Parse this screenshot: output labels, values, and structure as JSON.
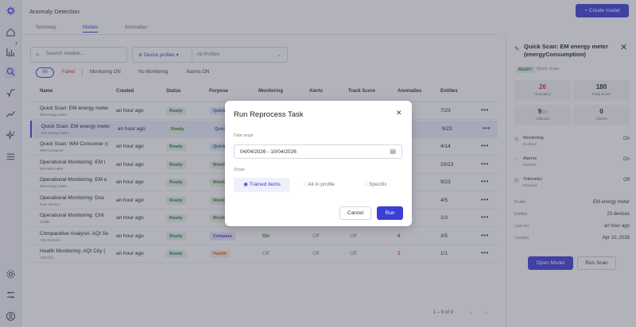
{
  "header": {
    "title": "Anomaly Detection",
    "create_label": "+ Create model"
  },
  "tabs": [
    {
      "label": "Summary"
    },
    {
      "label": "Models"
    },
    {
      "label": "Anomalies"
    }
  ],
  "filters": {
    "search_placeholder": "Search models...",
    "profile_label": "Device profiles",
    "profile_value": "All Profiles",
    "chips": [
      "All",
      "Failed",
      "Monitoring ON",
      "No Monitoring",
      "Alarms ON"
    ]
  },
  "table": {
    "columns": [
      "Name",
      "Created",
      "Status",
      "Purpose",
      "Monitoring",
      "Alerts",
      "Track Score",
      "Anomalies",
      "Entities"
    ],
    "rows": [
      {
        "name": "Quick Scan: EM energy meter",
        "sub": "EM energy meter",
        "created": "an hour ago",
        "status": "Ready",
        "purpose": "Quick",
        "entities": "7/23"
      },
      {
        "name": "Quick Scan: EM energy meter",
        "sub": "EM energy meter",
        "created": "an hour ago",
        "status": "Ready",
        "purpose": "Quick",
        "entities": "9/23"
      },
      {
        "name": "Quick Scan: WM Consumer (c",
        "sub": "WM Consumer",
        "created": "an hour ago",
        "status": "Ready",
        "purpose": "Quick",
        "entities": "4/14"
      },
      {
        "name": "Operational Monitoring: EM l",
        "sub": "EM heat meter",
        "created": "an hour ago",
        "status": "Ready",
        "purpose": "Monit",
        "entities": "20/23"
      },
      {
        "name": "Operational Monitoring: EM e",
        "sub": "EM energy meter",
        "created": "an hour ago",
        "status": "Ready",
        "purpose": "Monit",
        "entities": "9/23"
      },
      {
        "name": "Operational Monitoring: Doo",
        "sub": "Door Sensor",
        "created": "an hour ago",
        "status": "Ready",
        "purpose": "Monit",
        "entities": "4/5"
      },
      {
        "name": "Operational Monitoring: Chil",
        "sub": "Chiller",
        "created": "an hour ago",
        "status": "Ready",
        "purpose": "Monit",
        "entities": "1/3"
      },
      {
        "name": "Comparative Analysis: AQI Se",
        "sub": "AQI Sensors",
        "created": "an hour ago",
        "status": "Ready",
        "purpose": "Compare",
        "monitoring": "On",
        "alerts": "Off",
        "track": "Off",
        "anomalies": "6",
        "entities": "3/5"
      },
      {
        "name": "Health Monitoring: AQI City (",
        "sub": "AQI City",
        "created": "an hour ago",
        "status": "Ready",
        "purpose": "Health",
        "monitoring": "Off",
        "alerts": "Off",
        "track": "Off",
        "anomalies": "1",
        "entities": "1/1"
      }
    ],
    "pager": "1 – 9 of 9"
  },
  "panel": {
    "title": "Quick Scan: EM energy meter (energyConsumption)",
    "status": "READY",
    "purpose": "Quick Scan",
    "stats": [
      {
        "value": "26",
        "label": "Anomalies"
      },
      {
        "value": "180",
        "label": "Peak Score"
      },
      {
        "value": "9",
        "suffix": "/23",
        "label": "Affected"
      },
      {
        "value": "0",
        "label": "Alarms"
      }
    ],
    "features": [
      {
        "label": "Monitoring",
        "sub": "Enabled",
        "state": "On"
      },
      {
        "label": "Alarms",
        "sub": "Enabled",
        "state": "On"
      },
      {
        "label": "Telemetry",
        "sub": "Disabled",
        "state": "Off"
      }
    ],
    "details": [
      {
        "key": "Profile",
        "value": "EM energy meter"
      },
      {
        "key": "Entities",
        "value": "23 devices"
      },
      {
        "key": "Last run",
        "value": "an hour ago"
      },
      {
        "key": "Created",
        "value": "Apr 10, 2026"
      }
    ],
    "open_label": "Open Model",
    "scan_label": "Run Scan"
  },
  "modal": {
    "title": "Run Reprocess Task",
    "date_label": "Date range",
    "date_value": "04/04/2026 - 10/04/2026",
    "scope_label": "Scope",
    "scope_options": [
      "Trained items",
      "All in profile",
      "Specific"
    ],
    "cancel_label": "Cancel",
    "run_label": "Run"
  }
}
